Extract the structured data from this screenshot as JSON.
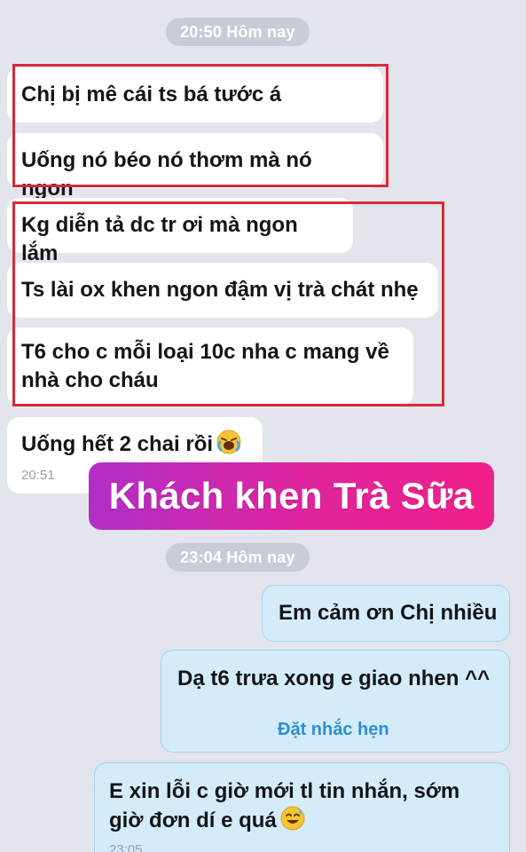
{
  "colors": {
    "background": "#e2e6ec",
    "incoming_bubble": "#ffffff",
    "outgoing_bubble": "#d4ecfa",
    "highlight_box": "#d92a3a",
    "sticker_gradient_start": "#b22ec8",
    "sticker_gradient_end": "#f0208a",
    "reminder_link": "#2a8fd0"
  },
  "separators": {
    "first": "20:50 Hôm nay",
    "second": "23:04 Hôm nay"
  },
  "incoming": [
    {
      "text": "Chị bị mê cái ts bá tước á"
    },
    {
      "text": "Uống nó béo nó thơm mà nó ngon"
    },
    {
      "text": "Kg diễn tả dc tr ơi mà ngon lắm"
    },
    {
      "text": "Ts lài ox khen ngon đậm vị trà chát nhẹ"
    },
    {
      "text": "T6 cho c mỗi loại 10c nha c mang về nhà cho cháu"
    },
    {
      "text": "Uống hết 2 chai rồi",
      "emoji": "laughing-crying-face-icon",
      "time": "20:51"
    }
  ],
  "sticker": {
    "text": "Khách khen Trà Sữa"
  },
  "outgoing": [
    {
      "text": "Em cảm ơn Chị nhiều"
    },
    {
      "text": "Dạ t6 trưa xong e giao nhen ^^",
      "action": "Đặt nhắc hẹn"
    },
    {
      "text": "E xin lỗi c giờ mới tl tin nhắn, sớm giờ đơn dí e quá",
      "emoji": "sweat-smile-face-icon",
      "time": "23:05"
    }
  ]
}
